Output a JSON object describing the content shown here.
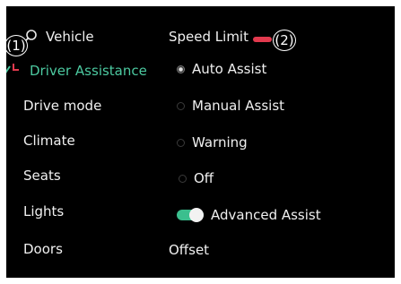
{
  "sidebar": {
    "search_label": "Vehicle",
    "items": [
      {
        "label": "Driver Assistance",
        "active": true
      },
      {
        "label": "Drive mode"
      },
      {
        "label": "Climate"
      },
      {
        "label": "Seats"
      },
      {
        "label": "Lights"
      },
      {
        "label": "Doors"
      }
    ]
  },
  "callouts": {
    "first": "(1)",
    "second": "(2)"
  },
  "main": {
    "section_title": "Speed Limit",
    "options": [
      {
        "label": "Auto Assist",
        "selected": true
      },
      {
        "label": "Manual Assist",
        "selected": false
      },
      {
        "label": "Warning",
        "selected": false
      },
      {
        "label": "Off",
        "selected": false
      }
    ],
    "toggle": {
      "label": "Advanced Assist",
      "on": true
    },
    "offset_label": "Offset"
  },
  "colors": {
    "accent": "#3bbf8e",
    "active_text": "#4cc9a0",
    "callout_marker": "#e23a4e",
    "background": "#000000"
  }
}
